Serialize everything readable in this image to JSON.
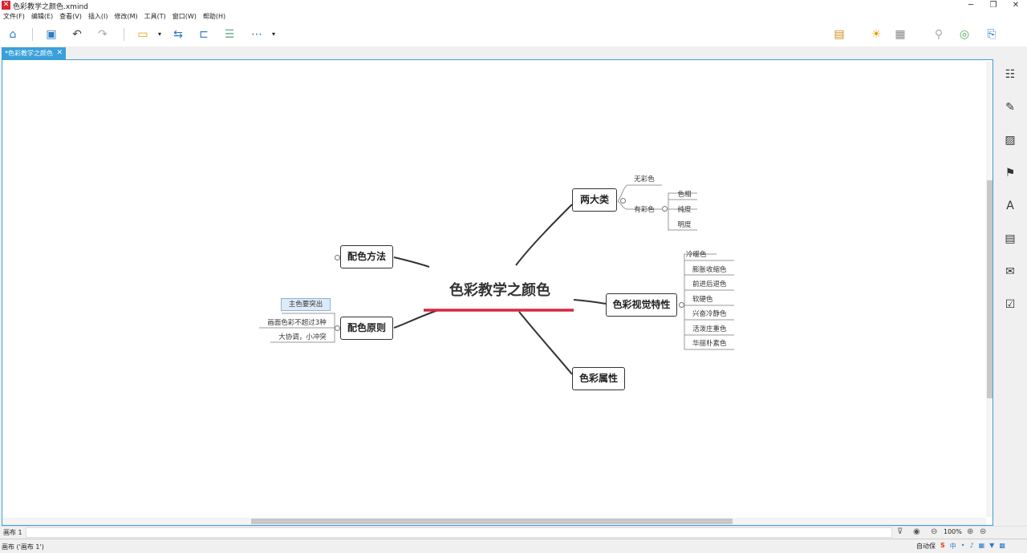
{
  "window": {
    "title": "色彩教学之颜色.xmind"
  },
  "menu": [
    "文件(F)",
    "编辑(E)",
    "查看(V)",
    "插入(I)",
    "修改(M)",
    "工具(T)",
    "窗口(W)",
    "帮助(H)"
  ],
  "tab": {
    "label": "*色彩教学之颜色",
    "close": "✕"
  },
  "map": {
    "central": "色彩教学之颜色",
    "accent": "#d9263e",
    "topics": {
      "liangdalei": "两大类",
      "peise_fangfa": "配色方法",
      "peise_yuanze": "配色原则",
      "shijue": "色彩视觉特性",
      "shuxing": "色彩属性"
    },
    "liangdalei_children": {
      "wucaise": "无彩色",
      "youcaise": "有彩色",
      "youcaise_children": [
        "色相",
        "纯度",
        "明度"
      ]
    },
    "yuanze_children": [
      "主色要突出",
      "画面色彩不超过3种",
      "大协调，小冲突"
    ],
    "shijue_children": [
      "冷暖色",
      "膨胀收缩色",
      "前进后退色",
      "软硬色",
      "兴奋冷静色",
      "活泼庄重色",
      "华丽朴素色"
    ]
  },
  "statusbar": {
    "sheet": "画布 1",
    "zoom": "100%"
  },
  "footer": {
    "status": "画布 ('画布 1')",
    "ime_label": "自动保",
    "ime_mode": "中"
  }
}
